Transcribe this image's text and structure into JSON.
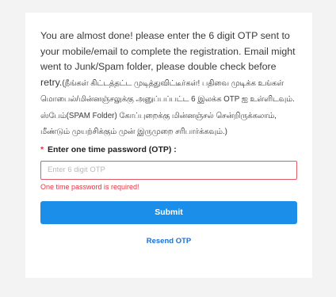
{
  "message": {
    "english": "You are almost done! please enter the 6 digit OTP sent to your mobile/email to complete the registration. Email might went to Junk/Spam folder, please double check before retry.",
    "tamil": "(நீங்கள் கிட்டத்தட்ட முடித்துவிட்டீர்கள்! பதிவை முடிக்க உங்கள் மொபைல்/மின்னஞ்சலுக்கு அனுப்பப்பட்ட 6 இலக்க OTP ஐ உள்ளிடவும். ஸ்பேம்(SPAM Folder) கோப்புறைக்கு மின்னஞ்சல் சென்றிருக்கலாம், மீண்டும் முயற்சிக்கும் முன் இருமுறை சரிபார்க்கவும்.)"
  },
  "otp": {
    "required_marker": "*",
    "label": "Enter one time password (OTP) :",
    "value": "",
    "placeholder": "Enter 6 digit OTP",
    "error": "One time password is required!"
  },
  "actions": {
    "submit_label": "Submit",
    "resend_label": "Resend OTP"
  },
  "colors": {
    "accent": "#1b8eea",
    "error": "#e03545",
    "link": "#1b6fd6"
  }
}
